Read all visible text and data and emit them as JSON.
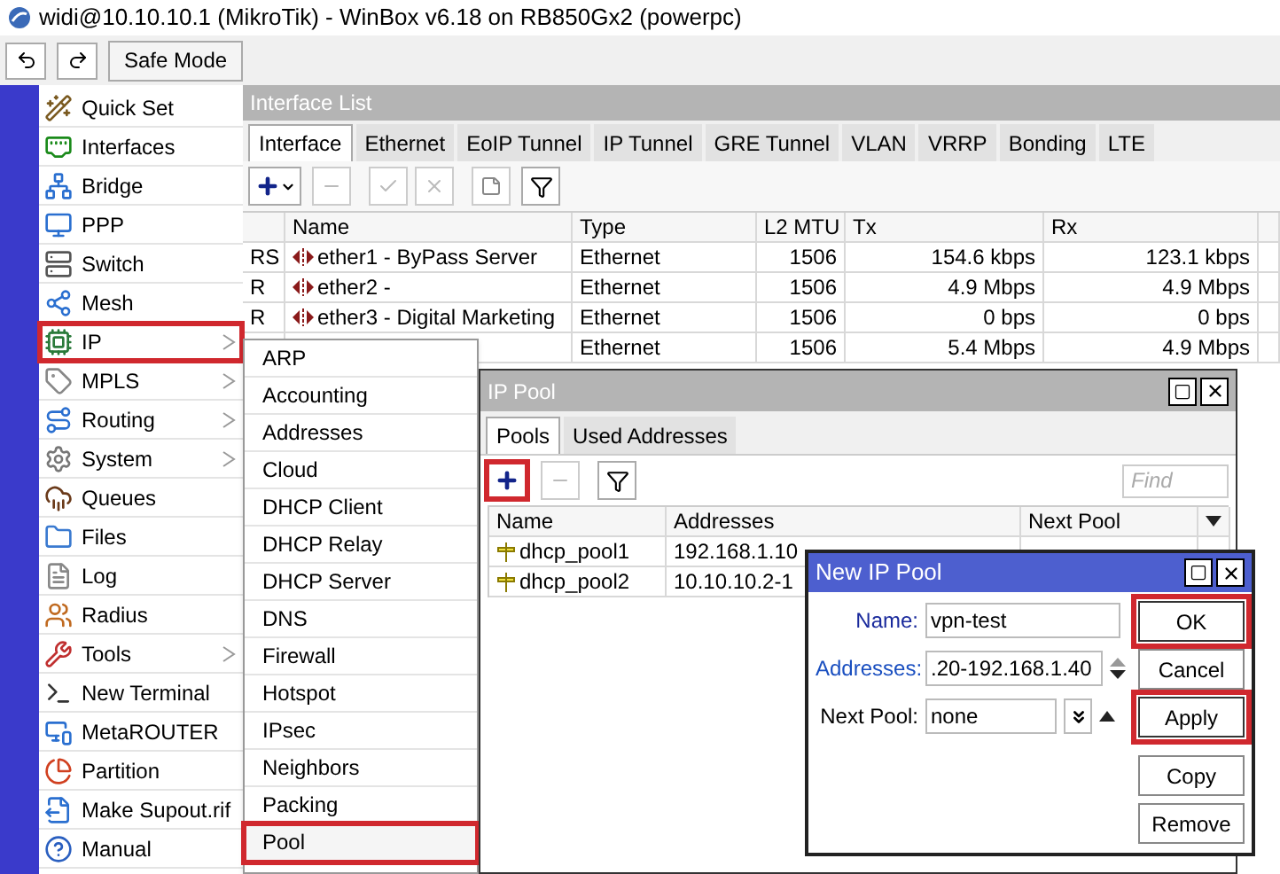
{
  "window": {
    "title": "widi@10.10.10.1 (MikroTik) - WinBox v6.18 on RB850Gx2 (powerpc)"
  },
  "toolbar": {
    "safe_mode": "Safe Mode"
  },
  "sidebar": {
    "items": [
      {
        "label": "Quick Set",
        "submenu": false,
        "highlighted": false
      },
      {
        "label": "Interfaces",
        "submenu": false,
        "highlighted": false
      },
      {
        "label": "Bridge",
        "submenu": false,
        "highlighted": false
      },
      {
        "label": "PPP",
        "submenu": false,
        "highlighted": false
      },
      {
        "label": "Switch",
        "submenu": false,
        "highlighted": false
      },
      {
        "label": "Mesh",
        "submenu": false,
        "highlighted": false
      },
      {
        "label": "IP",
        "submenu": true,
        "highlighted": true
      },
      {
        "label": "MPLS",
        "submenu": true,
        "highlighted": false
      },
      {
        "label": "Routing",
        "submenu": true,
        "highlighted": false
      },
      {
        "label": "System",
        "submenu": true,
        "highlighted": false
      },
      {
        "label": "Queues",
        "submenu": false,
        "highlighted": false
      },
      {
        "label": "Files",
        "submenu": false,
        "highlighted": false
      },
      {
        "label": "Log",
        "submenu": false,
        "highlighted": false
      },
      {
        "label": "Radius",
        "submenu": false,
        "highlighted": false
      },
      {
        "label": "Tools",
        "submenu": true,
        "highlighted": false
      },
      {
        "label": "New Terminal",
        "submenu": false,
        "highlighted": false
      },
      {
        "label": "MetaROUTER",
        "submenu": false,
        "highlighted": false
      },
      {
        "label": "Partition",
        "submenu": false,
        "highlighted": false
      },
      {
        "label": "Make Supout.rif",
        "submenu": false,
        "highlighted": false
      },
      {
        "label": "Manual",
        "submenu": false,
        "highlighted": false
      }
    ]
  },
  "submenu": {
    "items": [
      {
        "label": "ARP",
        "highlighted": false
      },
      {
        "label": "Accounting",
        "highlighted": false
      },
      {
        "label": "Addresses",
        "highlighted": false
      },
      {
        "label": "Cloud",
        "highlighted": false
      },
      {
        "label": "DHCP Client",
        "highlighted": false
      },
      {
        "label": "DHCP Relay",
        "highlighted": false
      },
      {
        "label": "DHCP Server",
        "highlighted": false
      },
      {
        "label": "DNS",
        "highlighted": false
      },
      {
        "label": "Firewall",
        "highlighted": false
      },
      {
        "label": "Hotspot",
        "highlighted": false
      },
      {
        "label": "IPsec",
        "highlighted": false
      },
      {
        "label": "Neighbors",
        "highlighted": false
      },
      {
        "label": "Packing",
        "highlighted": false
      },
      {
        "label": "Pool",
        "highlighted": true
      }
    ]
  },
  "interface_list": {
    "title": "Interface List",
    "tabs": [
      {
        "label": "Interface",
        "selected": true
      },
      {
        "label": "Ethernet",
        "selected": false
      },
      {
        "label": "EoIP Tunnel",
        "selected": false
      },
      {
        "label": "IP Tunnel",
        "selected": false
      },
      {
        "label": "GRE Tunnel",
        "selected": false
      },
      {
        "label": "VLAN",
        "selected": false
      },
      {
        "label": "VRRP",
        "selected": false
      },
      {
        "label": "Bonding",
        "selected": false
      },
      {
        "label": "LTE",
        "selected": false
      }
    ],
    "columns": [
      "Name",
      "Type",
      "L2 MTU",
      "Tx",
      "Rx"
    ],
    "rows": [
      {
        "flags": "RS",
        "name": "ether1 - ByPass Server",
        "type": "Ethernet",
        "l2mtu": "1506",
        "tx": "154.6 kbps",
        "rx": "123.1 kbps"
      },
      {
        "flags": "R",
        "name": "ether2 -",
        "type": "Ethernet",
        "l2mtu": "1506",
        "tx": "4.9 Mbps",
        "rx": "4.9 Mbps"
      },
      {
        "flags": "R",
        "name": "ether3 - Digital Marketing",
        "type": "Ethernet",
        "l2mtu": "1506",
        "tx": "0 bps",
        "rx": "0 bps"
      },
      {
        "type": "Ethernet",
        "l2mtu": "1506",
        "tx": "5.4 Mbps",
        "rx": "4.9 Mbps"
      }
    ]
  },
  "ip_pool": {
    "title": "IP Pool",
    "tabs": [
      {
        "label": "Pools",
        "selected": true
      },
      {
        "label": "Used Addresses",
        "selected": false
      }
    ],
    "add_highlighted": true,
    "find_placeholder": "Find",
    "columns": [
      "Name",
      "Addresses",
      "Next Pool"
    ],
    "rows": [
      {
        "name": "dhcp_pool1",
        "addresses": "192.168.1.10"
      },
      {
        "name": "dhcp_pool2",
        "addresses": "10.10.10.2-1"
      }
    ]
  },
  "dialog": {
    "title": "New IP Pool",
    "fields": [
      {
        "label": "Name:",
        "value": "vpn-test",
        "kind": "text",
        "color": "#1a2a9c"
      },
      {
        "label": "Addresses:",
        "value": ".20-192.168.1.40",
        "kind": "spin",
        "color": "#1a4fc0"
      },
      {
        "label": "Next Pool:",
        "value": "none",
        "kind": "select",
        "color": "#000000"
      }
    ],
    "buttons": [
      {
        "label": "OK",
        "highlighted": true
      },
      {
        "label": "Cancel",
        "highlighted": false
      },
      {
        "label": "Apply",
        "highlighted": true
      },
      {
        "label": "Copy",
        "highlighted": false
      },
      {
        "label": "Remove",
        "highlighted": false
      }
    ]
  }
}
